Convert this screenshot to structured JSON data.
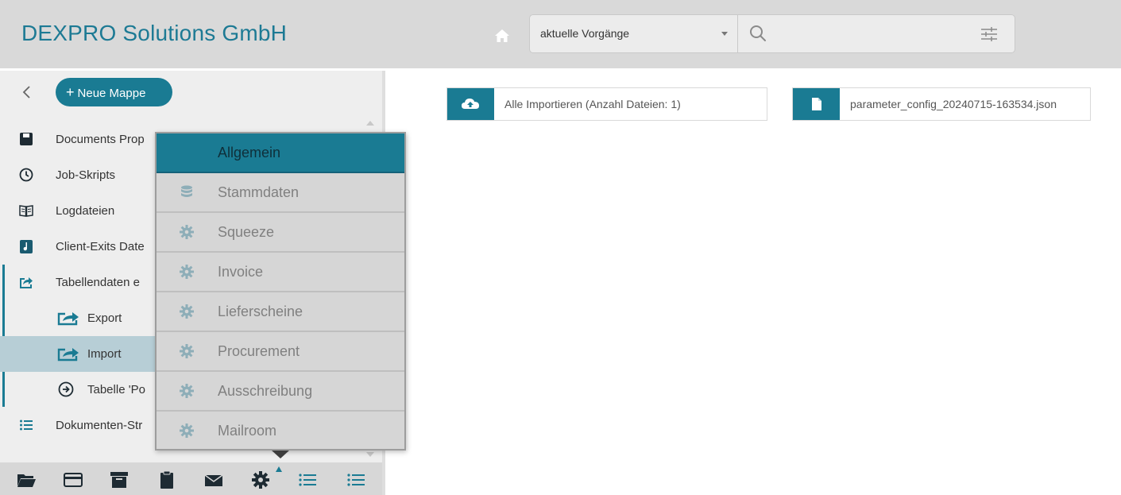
{
  "app": {
    "company": "DEXPRO Solutions GmbH"
  },
  "search": {
    "scope_value": "aktuelle Vorgänge",
    "placeholder": ""
  },
  "sidebar": {
    "new_folder_label": "Neue Mappe",
    "items": [
      {
        "label": "Documents Prop",
        "icon": "floppy-disk-icon"
      },
      {
        "label": "Job-Skripts",
        "icon": "clock-icon"
      },
      {
        "label": "Logdateien",
        "icon": "book-icon"
      },
      {
        "label": "Client-Exits Date",
        "icon": "music-note-icon"
      },
      {
        "label": "Tabellendaten e",
        "icon": "share-icon"
      },
      {
        "label": "Export",
        "icon": "share-icon"
      },
      {
        "label": "Import",
        "icon": "share-icon"
      },
      {
        "label": "Tabelle 'Po",
        "icon": "arrow-circle-icon"
      },
      {
        "label": "Dokumenten-Str",
        "icon": "list-icon"
      }
    ],
    "toolbar": [
      "folder-open-icon",
      "credit-card-icon",
      "archive-icon",
      "clipboard-icon",
      "envelope-icon",
      "gear-icon",
      "list-icon",
      "list-icon"
    ]
  },
  "dropdown": {
    "items": [
      {
        "label": "Allgemein",
        "icon": "",
        "selected": true
      },
      {
        "label": "Stammdaten",
        "icon": "database-icon"
      },
      {
        "label": "Squeeze",
        "icon": "gear-icon"
      },
      {
        "label": "Invoice",
        "icon": "gear-icon"
      },
      {
        "label": "Lieferscheine",
        "icon": "gear-icon"
      },
      {
        "label": "Procurement",
        "icon": "gear-icon"
      },
      {
        "label": "Ausschreibung",
        "icon": "gear-icon"
      },
      {
        "label": "Mailroom",
        "icon": "gear-icon"
      }
    ]
  },
  "main": {
    "import_all_label": "Alle Importieren (Anzahl Dateien: 1)",
    "file_label": "parameter_config_20240715-163534.json"
  },
  "colors": {
    "accent": "#1a7b93",
    "header_bg": "#d9d9d9",
    "sidebar_bg": "#eeeeee",
    "active_row": "#b7ced6"
  }
}
